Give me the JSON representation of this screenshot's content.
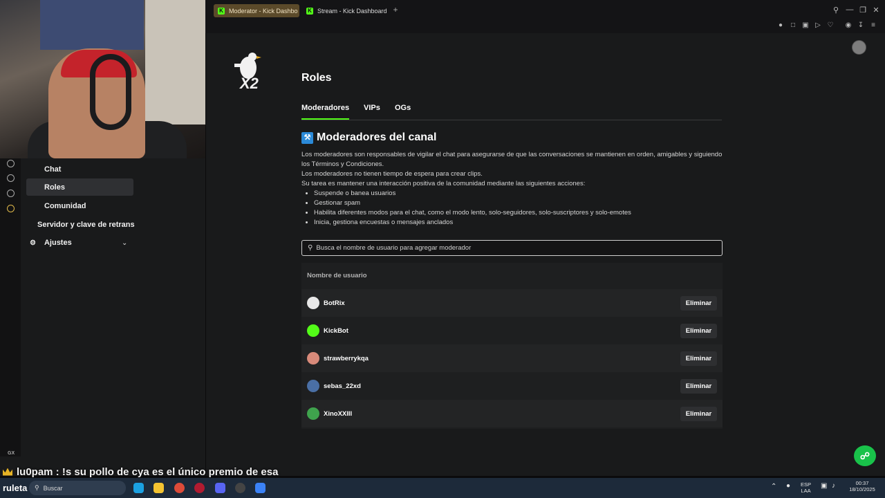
{
  "browser": {
    "tabs": [
      {
        "label": "Moderator - Kick Dashbo",
        "active": true
      },
      {
        "label": "Stream - Kick Dashboard",
        "active": false
      }
    ],
    "new_tab": "+"
  },
  "sidebar": {
    "items": [
      {
        "label": "Chat",
        "selected": false
      },
      {
        "label": "Roles",
        "selected": true
      },
      {
        "label": "Comunidad",
        "selected": false
      },
      {
        "label": "Servidor y clave de retrans",
        "selected": false
      },
      {
        "label": "Ajustes",
        "selected": false
      }
    ],
    "gx_label": "GX"
  },
  "logo": {
    "text": "X2"
  },
  "page": {
    "title": "Roles",
    "tabs": [
      {
        "label": "Moderadores",
        "active": true
      },
      {
        "label": "VIPs",
        "active": false
      },
      {
        "label": "OGs",
        "active": false
      }
    ],
    "section_title": "Moderadores del canal",
    "description": {
      "p1": "Los moderadores son responsables de vigilar el chat para asegurarse de que las conversaciones se mantienen en orden, amigables y siguiendo los Términos y Condiciones.",
      "p2": "Los moderadores no tienen tiempo de espera para crear clips.",
      "p3": "Su tarea es mantener una interacción positiva de la comunidad mediante las siguientes acciones:",
      "bullets": [
        "Suspende o banea usuarios",
        "Gestionar spam",
        "Habilita diferentes modos para el chat, como el modo lento, solo-seguidores, solo-suscriptores y solo-emotes",
        "Inicia, gestiona encuestas o mensajes anclados"
      ]
    },
    "search_placeholder": "Busca el nombre de usuario para agregar moderador",
    "table": {
      "header": "Nombre de usuario",
      "rows": [
        {
          "username": "BotRix",
          "action": "Eliminar",
          "avatar_color": "#e8e8e8"
        },
        {
          "username": "KickBot",
          "action": "Eliminar",
          "avatar_color": "#53fc18"
        },
        {
          "username": "strawberrykqa",
          "action": "Eliminar",
          "avatar_color": "#d88a7a"
        },
        {
          "username": "sebas_22xd",
          "action": "Eliminar",
          "avatar_color": "#4a6fa5"
        },
        {
          "username": "XinoXXIII",
          "action": "Eliminar",
          "avatar_color": "#3fa34d"
        }
      ]
    }
  },
  "chat_overlay": {
    "message": "lu0pam : !s su pollo de cya es el único premio de esa"
  },
  "taskbar": {
    "brand": "ruleta",
    "search_label": "Buscar",
    "lang": "ESP",
    "lang_sub": "LAA",
    "time": "00:37",
    "date": "18/10/2025"
  },
  "colors": {
    "accent": "#53fc18",
    "help": "#19c24a"
  }
}
